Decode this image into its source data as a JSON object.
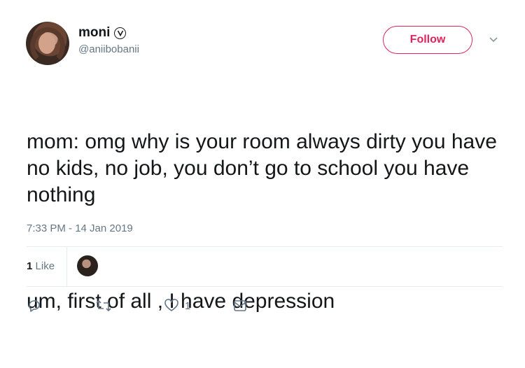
{
  "user": {
    "display_name": "moni",
    "handle": "@aniibobanii",
    "verified": true
  },
  "follow_label": "Follow",
  "tweet": {
    "paragraph_1": "mom: omg why is your room always dirty you have no kids, no job, you don’t go to school you have nothing",
    "paragraph_2": "um, first of all , I have depression"
  },
  "timestamp": "7:33 PM - 14 Jan 2019",
  "stats": {
    "likes_count": "1",
    "likes_label": "Like"
  },
  "actions": {
    "like_count": "1"
  },
  "icons": {
    "verified": "verified-badge-icon",
    "caret": "chevron-down-icon",
    "reply": "reply-icon",
    "retweet": "retweet-icon",
    "like": "heart-icon",
    "dm": "envelope-icon"
  },
  "colors": {
    "follow_accent": "#e0245e",
    "muted_text": "#657786"
  }
}
